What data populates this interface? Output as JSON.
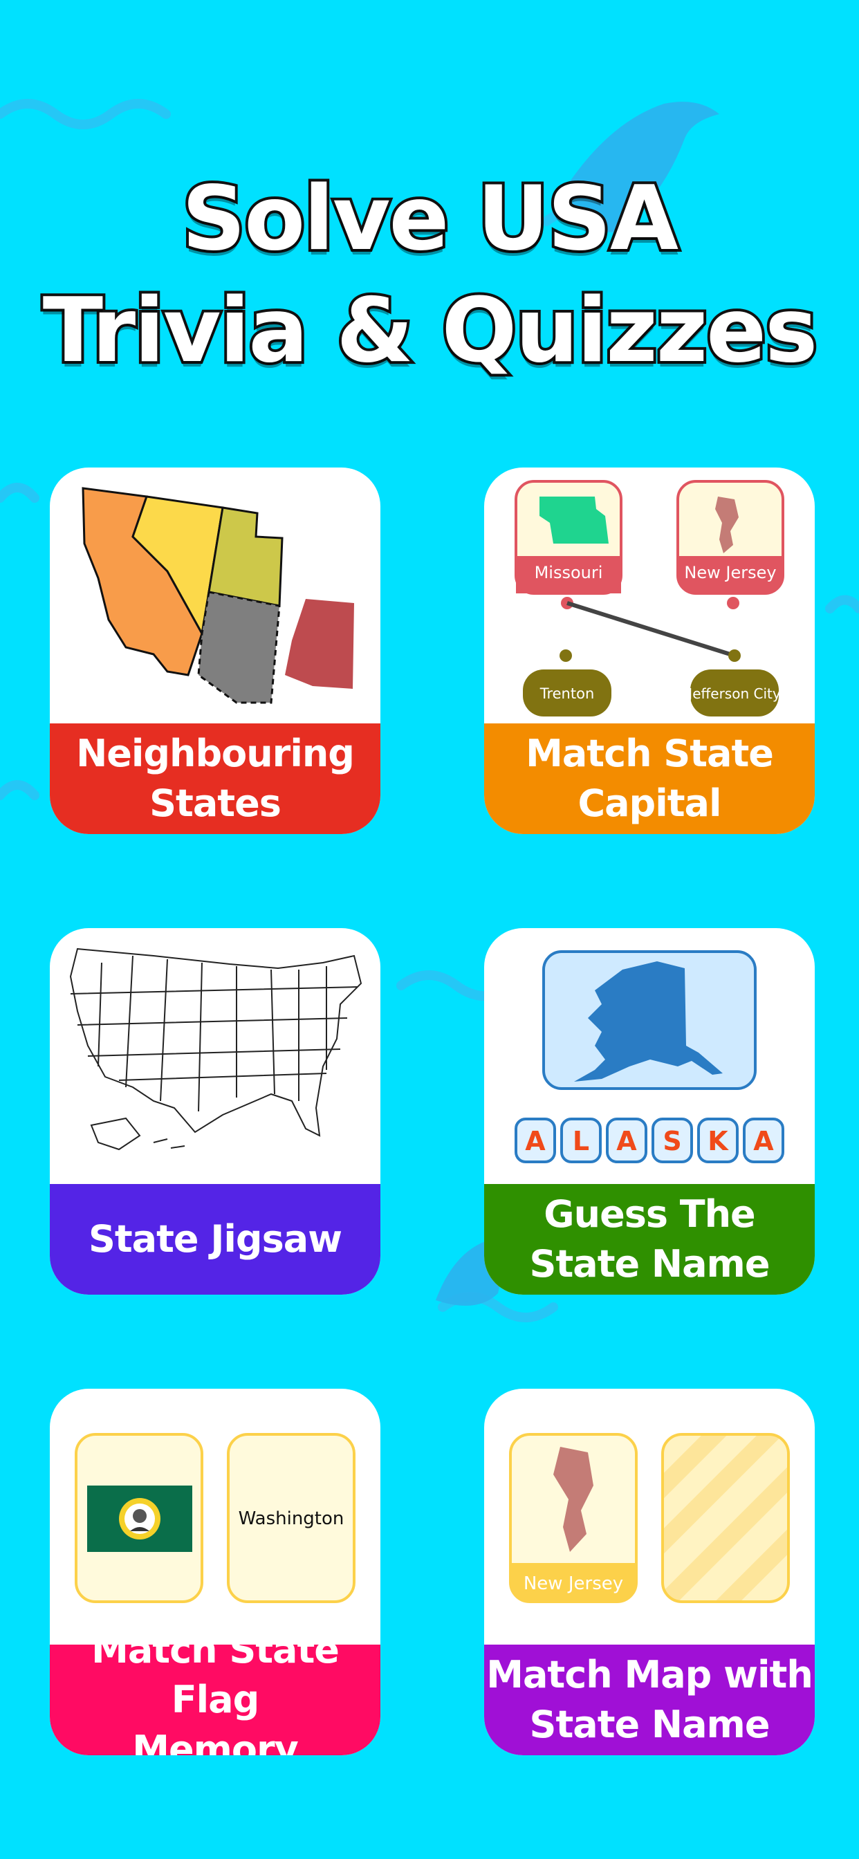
{
  "header": {
    "line1": "Solve USA",
    "line2": "Trivia & Quizzes"
  },
  "colors": {
    "background": "#00e1ff",
    "neighbouring": "#e62e22",
    "match_capital": "#f38c00",
    "jigsaw": "#5424e6",
    "guess_name": "#2f9000",
    "flag_memory": "#ff0b63",
    "map_name": "#a010d6"
  },
  "cards": [
    {
      "label": "Neighbouring\nStates",
      "icon": "neighbour-map-icon"
    },
    {
      "label": "Match State\nCapital",
      "states": [
        "Missouri",
        "New Jersey"
      ],
      "capitals": [
        "Trenton",
        "Jefferson City"
      ],
      "icon": "state-capital-icon"
    },
    {
      "label": "State Jigsaw",
      "icon": "usa-outline-map-icon"
    },
    {
      "label": "Guess The\nState Name",
      "letters": [
        "A",
        "L",
        "A",
        "S",
        "K",
        "A"
      ],
      "icon": "alaska-map-icon"
    },
    {
      "label": "Match State Flag\nMemory",
      "flag_caption": "Washington",
      "icon": "washington-flag-icon"
    },
    {
      "label": "Match Map with\nState Name",
      "map_caption": "New Jersey",
      "icon": "new-jersey-map-icon"
    }
  ]
}
